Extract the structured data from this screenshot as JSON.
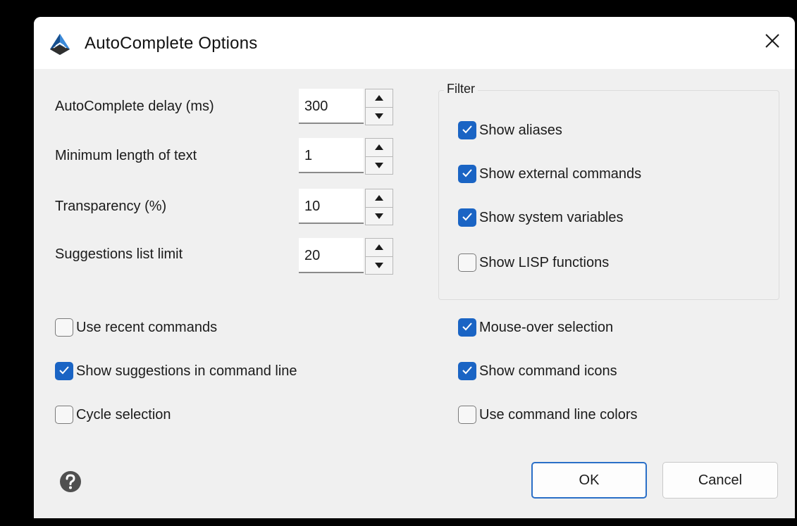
{
  "window": {
    "title": "AutoComplete Options",
    "app_icon": "app-logo-icon",
    "close_icon": "close-icon"
  },
  "settings": [
    {
      "label": "AutoComplete delay (ms)",
      "value": "300"
    },
    {
      "label": "Minimum length of text",
      "value": "1"
    },
    {
      "label": "Transparency (%)",
      "value": "10"
    },
    {
      "label": "Suggestions list limit",
      "value": "20"
    }
  ],
  "filter": {
    "title": "Filter",
    "options": [
      {
        "label": "Show aliases",
        "checked": true
      },
      {
        "label": "Show external commands",
        "checked": true
      },
      {
        "label": "Show system variables",
        "checked": true
      },
      {
        "label": "Show LISP functions",
        "checked": false
      }
    ]
  },
  "left_options": [
    {
      "label": "Use recent commands",
      "checked": false
    },
    {
      "label": "Show suggestions in command line",
      "checked": true
    },
    {
      "label": "Cycle selection",
      "checked": false
    }
  ],
  "right_options": [
    {
      "label": "Mouse-over selection",
      "checked": true
    },
    {
      "label": "Show command icons",
      "checked": true
    },
    {
      "label": "Use command line colors",
      "checked": false
    }
  ],
  "buttons": {
    "ok": "OK",
    "cancel": "Cancel"
  },
  "colors": {
    "accent": "#1a64c4",
    "background": "#f0f0f0",
    "titlebar": "#ffffff"
  },
  "icons": {
    "help": "help-question-icon",
    "spin_up": "arrow-up-icon",
    "spin_down": "arrow-down-icon",
    "check": "checkmark-icon"
  }
}
